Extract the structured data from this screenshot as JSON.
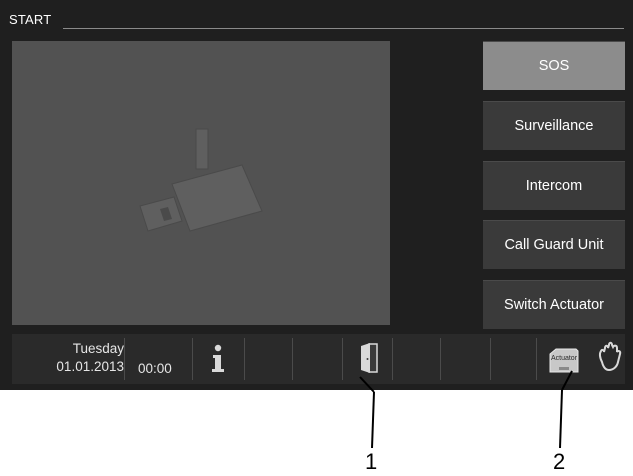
{
  "screen": {
    "title": "START"
  },
  "side_menu": {
    "items": [
      {
        "label": "SOS",
        "active": true
      },
      {
        "label": "Surveillance",
        "active": false
      },
      {
        "label": "Intercom",
        "active": false
      },
      {
        "label": "Call Guard Unit",
        "active": false
      },
      {
        "label": "Switch Actuator",
        "active": false
      }
    ]
  },
  "status_bar": {
    "day": "Tuesday",
    "date": "01.01.2013",
    "time": "00:00",
    "actuator_label": "Actuator",
    "icons": [
      "info-icon",
      "door-icon",
      "actuator-icon",
      "hand-icon"
    ]
  },
  "callouts": [
    {
      "label": "1",
      "points_to": "door-icon"
    },
    {
      "label": "2",
      "points_to": "actuator-icon"
    }
  ],
  "colors": {
    "panel": "#1f1f1f",
    "video": "#525252",
    "button": "#3a3a3a",
    "button_active": "#8c8c8c",
    "text": "#ffffff"
  }
}
